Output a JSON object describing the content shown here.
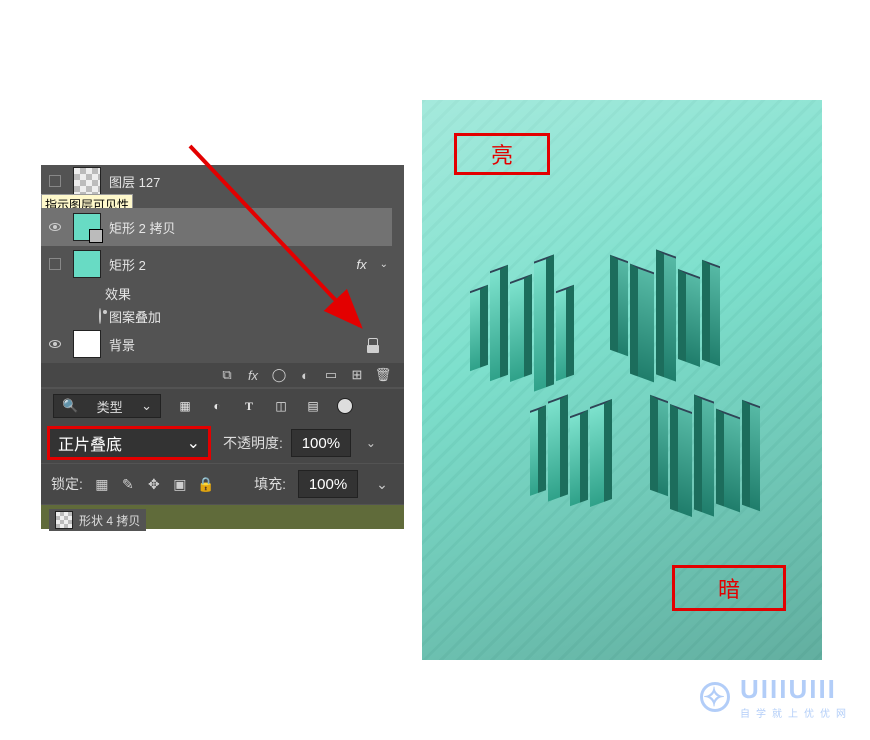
{
  "panel": {
    "tooltip": "指示图层可见性",
    "layer127": "图层 127",
    "rect2copy": "矩形 2 拷贝",
    "rect2": "矩形 2",
    "fx": "fx",
    "effects": "效果",
    "patternOverlay": "图案叠加",
    "background": "背景",
    "filterLabel": "类型",
    "blendMode": "正片叠底",
    "opacityLabel": "不透明度:",
    "opacityValue": "100%",
    "lockLabel": "锁定:",
    "fillLabel": "填充:",
    "fillValue": "100%",
    "stubLabel": "形状 4 拷贝"
  },
  "preview": {
    "bright": "亮",
    "dark": "暗"
  },
  "watermark": {
    "brand": "UIIIUIII",
    "sub": "自学就上优优网"
  }
}
